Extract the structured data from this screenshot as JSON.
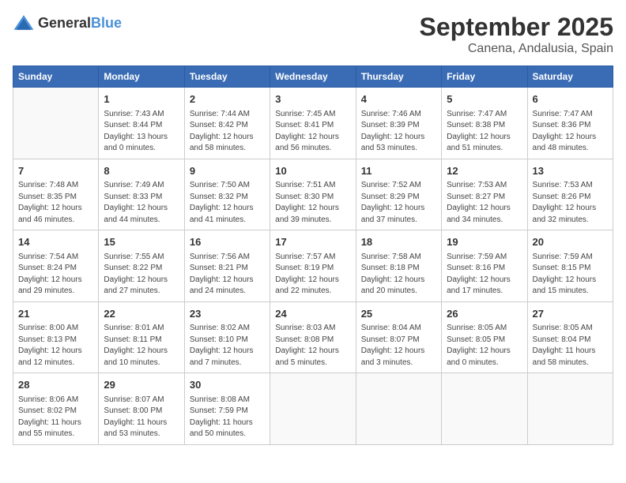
{
  "logo": {
    "general": "General",
    "blue": "Blue"
  },
  "title": "September 2025",
  "location": "Canena, Andalusia, Spain",
  "weekdays": [
    "Sunday",
    "Monday",
    "Tuesday",
    "Wednesday",
    "Thursday",
    "Friday",
    "Saturday"
  ],
  "weeks": [
    [
      {
        "day": "",
        "sunrise": "",
        "sunset": "",
        "daylight": ""
      },
      {
        "day": "1",
        "sunrise": "7:43 AM",
        "sunset": "8:44 PM",
        "daylight": "13 hours and 0 minutes."
      },
      {
        "day": "2",
        "sunrise": "7:44 AM",
        "sunset": "8:42 PM",
        "daylight": "12 hours and 58 minutes."
      },
      {
        "day": "3",
        "sunrise": "7:45 AM",
        "sunset": "8:41 PM",
        "daylight": "12 hours and 56 minutes."
      },
      {
        "day": "4",
        "sunrise": "7:46 AM",
        "sunset": "8:39 PM",
        "daylight": "12 hours and 53 minutes."
      },
      {
        "day": "5",
        "sunrise": "7:47 AM",
        "sunset": "8:38 PM",
        "daylight": "12 hours and 51 minutes."
      },
      {
        "day": "6",
        "sunrise": "7:47 AM",
        "sunset": "8:36 PM",
        "daylight": "12 hours and 48 minutes."
      }
    ],
    [
      {
        "day": "7",
        "sunrise": "7:48 AM",
        "sunset": "8:35 PM",
        "daylight": "12 hours and 46 minutes."
      },
      {
        "day": "8",
        "sunrise": "7:49 AM",
        "sunset": "8:33 PM",
        "daylight": "12 hours and 44 minutes."
      },
      {
        "day": "9",
        "sunrise": "7:50 AM",
        "sunset": "8:32 PM",
        "daylight": "12 hours and 41 minutes."
      },
      {
        "day": "10",
        "sunrise": "7:51 AM",
        "sunset": "8:30 PM",
        "daylight": "12 hours and 39 minutes."
      },
      {
        "day": "11",
        "sunrise": "7:52 AM",
        "sunset": "8:29 PM",
        "daylight": "12 hours and 37 minutes."
      },
      {
        "day": "12",
        "sunrise": "7:53 AM",
        "sunset": "8:27 PM",
        "daylight": "12 hours and 34 minutes."
      },
      {
        "day": "13",
        "sunrise": "7:53 AM",
        "sunset": "8:26 PM",
        "daylight": "12 hours and 32 minutes."
      }
    ],
    [
      {
        "day": "14",
        "sunrise": "7:54 AM",
        "sunset": "8:24 PM",
        "daylight": "12 hours and 29 minutes."
      },
      {
        "day": "15",
        "sunrise": "7:55 AM",
        "sunset": "8:22 PM",
        "daylight": "12 hours and 27 minutes."
      },
      {
        "day": "16",
        "sunrise": "7:56 AM",
        "sunset": "8:21 PM",
        "daylight": "12 hours and 24 minutes."
      },
      {
        "day": "17",
        "sunrise": "7:57 AM",
        "sunset": "8:19 PM",
        "daylight": "12 hours and 22 minutes."
      },
      {
        "day": "18",
        "sunrise": "7:58 AM",
        "sunset": "8:18 PM",
        "daylight": "12 hours and 20 minutes."
      },
      {
        "day": "19",
        "sunrise": "7:59 AM",
        "sunset": "8:16 PM",
        "daylight": "12 hours and 17 minutes."
      },
      {
        "day": "20",
        "sunrise": "7:59 AM",
        "sunset": "8:15 PM",
        "daylight": "12 hours and 15 minutes."
      }
    ],
    [
      {
        "day": "21",
        "sunrise": "8:00 AM",
        "sunset": "8:13 PM",
        "daylight": "12 hours and 12 minutes."
      },
      {
        "day": "22",
        "sunrise": "8:01 AM",
        "sunset": "8:11 PM",
        "daylight": "12 hours and 10 minutes."
      },
      {
        "day": "23",
        "sunrise": "8:02 AM",
        "sunset": "8:10 PM",
        "daylight": "12 hours and 7 minutes."
      },
      {
        "day": "24",
        "sunrise": "8:03 AM",
        "sunset": "8:08 PM",
        "daylight": "12 hours and 5 minutes."
      },
      {
        "day": "25",
        "sunrise": "8:04 AM",
        "sunset": "8:07 PM",
        "daylight": "12 hours and 3 minutes."
      },
      {
        "day": "26",
        "sunrise": "8:05 AM",
        "sunset": "8:05 PM",
        "daylight": "12 hours and 0 minutes."
      },
      {
        "day": "27",
        "sunrise": "8:05 AM",
        "sunset": "8:04 PM",
        "daylight": "11 hours and 58 minutes."
      }
    ],
    [
      {
        "day": "28",
        "sunrise": "8:06 AM",
        "sunset": "8:02 PM",
        "daylight": "11 hours and 55 minutes."
      },
      {
        "day": "29",
        "sunrise": "8:07 AM",
        "sunset": "8:00 PM",
        "daylight": "11 hours and 53 minutes."
      },
      {
        "day": "30",
        "sunrise": "8:08 AM",
        "sunset": "7:59 PM",
        "daylight": "11 hours and 50 minutes."
      },
      {
        "day": "",
        "sunrise": "",
        "sunset": "",
        "daylight": ""
      },
      {
        "day": "",
        "sunrise": "",
        "sunset": "",
        "daylight": ""
      },
      {
        "day": "",
        "sunrise": "",
        "sunset": "",
        "daylight": ""
      },
      {
        "day": "",
        "sunrise": "",
        "sunset": "",
        "daylight": ""
      }
    ]
  ]
}
